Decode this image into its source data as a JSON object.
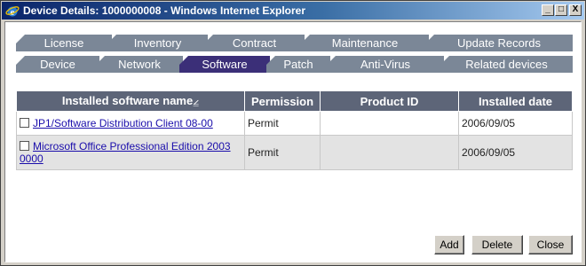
{
  "window": {
    "title": "Device Details: 1000000008 - Windows Internet Explorer",
    "minimize": "_",
    "maximize": "□",
    "close": "X"
  },
  "tabs_top": [
    {
      "label": "License"
    },
    {
      "label": "Inventory"
    },
    {
      "label": "Contract"
    },
    {
      "label": "Maintenance"
    },
    {
      "label": "Update Records"
    }
  ],
  "tabs_bottom": [
    {
      "label": "Device"
    },
    {
      "label": "Network"
    },
    {
      "label": "Software",
      "active": true
    },
    {
      "label": "Patch"
    },
    {
      "label": "Anti-Virus"
    },
    {
      "label": "Related devices"
    }
  ],
  "table": {
    "headers": [
      "Installed software name",
      "Permission",
      "Product ID",
      "Installed date"
    ],
    "sort_indicator": "⦤",
    "rows": [
      {
        "name": "JP1/Software Distribution Client 08-00",
        "permission": "Permit",
        "product_id": "",
        "date": "2006/09/05"
      },
      {
        "name": "Microsoft Office Professional Edition 2003 0000",
        "permission": "Permit",
        "product_id": "",
        "date": "2006/09/05"
      }
    ]
  },
  "buttons": {
    "add": "Add",
    "delete": "Delete",
    "close": "Close"
  },
  "colors": {
    "tab": "#7b8797",
    "tab_active": "#3b2f78",
    "header": "#5d6578"
  }
}
